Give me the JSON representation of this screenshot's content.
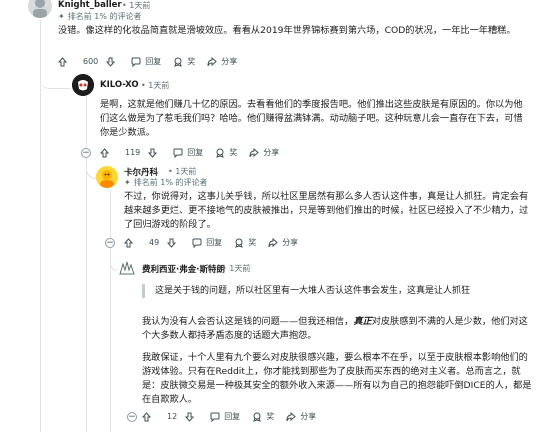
{
  "comments": [
    {
      "username": "Knight_baller",
      "time": "• 1天前",
      "badge": "排名前 1% 的评论者",
      "text": "没错。像这样的化妆品简直就是滑坡效应。看看从2019年世界锦标赛到第六场，COD的状况，一年比一年糟糕。",
      "votes": "600",
      "reply": "回复",
      "award": "奖",
      "share": "分享"
    },
    {
      "username": "KILO-XO",
      "time": "• 1天前",
      "text": "是啊，这就是他们赚几十亿的原因。去看看他们的季度报告吧。他们推出这些皮肤是有原因的。你以为他们这么做是为了惹毛我们吗？哈哈。他们赚得盆满钵满。动动脑子吧。这种玩意儿会一直存在下去，可惜你是少数派。",
      "votes": "119",
      "reply": "回复",
      "award": "奖",
      "share": "分享"
    },
    {
      "username": "卡尔丹科",
      "time": "• 1天前",
      "badge": "排名前 1% 的评论者",
      "text": "不过，你说得对，这事儿关乎钱，所以社区里居然有那么多人否认这件事，真是让人抓狂。肯定会有越来越多更烂、更不接地气的皮肤被推出，只是等到他们推出的时候，社区已经投入了不少精力，过了回归游戏的阶段了。",
      "votes": "49",
      "reply": "回复",
      "award": "奖",
      "share": "分享"
    },
    {
      "username": "费利西亚·弗金·斯特朗",
      "time": "• 1天前",
      "quote": "这是关于钱的问题，所以社区里有一大堆人否认这件事会发生，这真是让人抓狂",
      "para1_a": "我认为没有人会否认这是钱的问题——但我还相信，",
      "para1_em": "真正",
      "para1_b": "对皮肤感到不满的人是少数，他们对这个大多数人都持矛盾态度的话题大声抱怨。",
      "para2": "我敢保证，十个人里有九个要么对皮肤很感兴趣，要么根本不在乎，以至于皮肤根本影响他们的游戏体验。只有在Reddit上，你才能找到那些为了皮肤而买东西的绝对主义者。总而言之，就是：皮肤微交易是一种极其安全的额外收入来源——所有以为自己的抱怨能吓倒DICE的人，都是在自欺欺人。",
      "votes": "12",
      "reply": "回复",
      "award": "奖",
      "share": "分享"
    }
  ],
  "icons": [
    "upvote-icon",
    "downvote-icon",
    "comment-icon",
    "award-icon",
    "share-icon",
    "expand-icon",
    "star-icon"
  ]
}
